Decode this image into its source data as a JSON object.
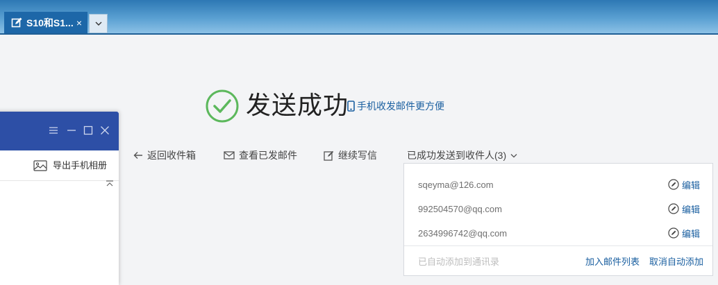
{
  "tab": {
    "title": "S10和S1...",
    "close_glyph": "×",
    "icon": "edit-icon",
    "dropdown_icon": "chevron-down-icon"
  },
  "success": {
    "title": "发送成功",
    "mobile_link": "手机收发邮件更方便",
    "icon": "check-circle-icon"
  },
  "actions": {
    "back": "返回收件箱",
    "view_sent": "查看已发邮件",
    "continue_write": "继续写信",
    "recipients_summary": "已成功发送到收件人(3)"
  },
  "recipients": {
    "list": [
      {
        "email": "sqeyma@126.com",
        "edit_label": "编辑"
      },
      {
        "email": "992504570@qq.com",
        "edit_label": "编辑"
      },
      {
        "email": "2634996742@qq.com",
        "edit_label": "编辑"
      }
    ],
    "auto_added_label": "已自动添加到通讯录",
    "add_to_list_label": "加入邮件列表",
    "cancel_auto_label": "取消自动添加"
  },
  "side_window": {
    "export_label": "导出手机相册",
    "controls": [
      "menu-icon",
      "minimize-icon",
      "maximize-icon",
      "close-icon"
    ]
  },
  "colors": {
    "accent": "#1a5fa0",
    "success": "#5cb85c",
    "tab_bg": "#1d67a8",
    "side_header": "#2d4fa6"
  }
}
